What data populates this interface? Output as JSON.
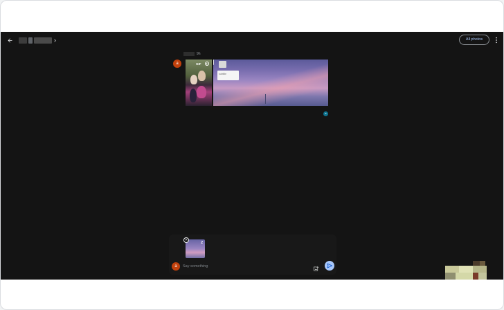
{
  "header": {
    "back_icon": "arrow-back-icon",
    "album_chevron": "›",
    "all_photos_label": "All photos",
    "more_icon": "more-vert-icon"
  },
  "feed": {
    "time_label": "9h",
    "avatar_initial": "a",
    "items": [
      {
        "type": "animation",
        "badge": "GIF"
      },
      {
        "type": "photo",
        "caption": "subtitle"
      }
    ],
    "seen_initial": "a"
  },
  "composer": {
    "attachment_count": "2",
    "avatar_initial": "a",
    "placeholder": "Say something"
  },
  "colors": {
    "background": "#141414",
    "accent": "#a8c7fa",
    "avatar": "#c2410c",
    "seen_avatar": "#0e7490"
  }
}
